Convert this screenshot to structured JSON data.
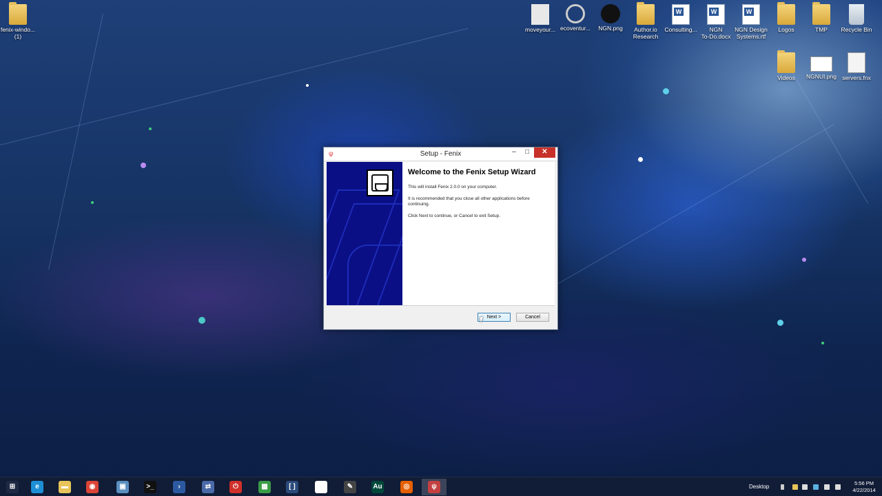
{
  "desktop": {
    "icons": [
      {
        "label": "fenix-windo...\n(1)",
        "kind": "folder"
      },
      {
        "label": "moveyour...",
        "kind": "image"
      },
      {
        "label": "ecoventur...",
        "kind": "app"
      },
      {
        "label": "NGN.png",
        "kind": "image"
      },
      {
        "label": "Author.io\nResearch",
        "kind": "folder"
      },
      {
        "label": "Consulting...",
        "kind": "doc"
      },
      {
        "label": "NGN\nTo-Do.docx",
        "kind": "doc"
      },
      {
        "label": "NGN Design\nSystems.rtf",
        "kind": "doc"
      },
      {
        "label": "Logos",
        "kind": "folder"
      },
      {
        "label": "TMP",
        "kind": "folder"
      },
      {
        "label": "Recycle Bin",
        "kind": "recycle"
      },
      {
        "label": "Videos",
        "kind": "folder"
      },
      {
        "label": "NGNUI.png",
        "kind": "image"
      },
      {
        "label": "servers.fnx",
        "kind": "file"
      }
    ]
  },
  "setup_window": {
    "title": "Setup - Fenix",
    "minimize_glyph": "–",
    "maximize_glyph": "□",
    "close_glyph": "✕",
    "heading": "Welcome to the Fenix Setup Wizard",
    "paragraphs": [
      "This will install Fenix 2.0.0 on your computer.",
      "It is recommended that you close all other applications before continuing.",
      "Click Next to continue, or Cancel to exit Setup."
    ],
    "next_label": "Next >",
    "cancel_label": "Cancel"
  },
  "taskbar": {
    "apps": [
      {
        "name": "start-button",
        "glyph": "⊞",
        "color": "#1e2a44"
      },
      {
        "name": "internet-explorer",
        "glyph": "e",
        "color": "#1e8fd6"
      },
      {
        "name": "file-explorer",
        "glyph": "▬",
        "color": "#e8c45a"
      },
      {
        "name": "chrome",
        "glyph": "◉",
        "color": "#db4437"
      },
      {
        "name": "remote-desktop",
        "glyph": "▣",
        "color": "#5a8fc0"
      },
      {
        "name": "command-prompt",
        "glyph": ">_",
        "color": "#111111"
      },
      {
        "name": "powershell",
        "glyph": "›",
        "color": "#2c5aa0"
      },
      {
        "name": "network-tool",
        "glyph": "⇄",
        "color": "#4a6aa8"
      },
      {
        "name": "power-app",
        "glyph": "⏻",
        "color": "#d0302a"
      },
      {
        "name": "app-grid",
        "glyph": "▦",
        "color": "#3a9c46"
      },
      {
        "name": "bracket-app",
        "glyph": "[ ]",
        "color": "#2a4a7a"
      },
      {
        "name": "blank-document",
        "glyph": "",
        "color": "#ffffff"
      },
      {
        "name": "pen-tool",
        "glyph": "✎",
        "color": "#444444"
      },
      {
        "name": "adobe-audition",
        "glyph": "Au",
        "color": "#00483a"
      },
      {
        "name": "firefox",
        "glyph": "◎",
        "color": "#e66000"
      },
      {
        "name": "fenix-setup",
        "glyph": "ψ",
        "color": "#c44040"
      }
    ],
    "desktop_label": "Desktop",
    "time": "5:56 PM",
    "date": "4/22/2014"
  }
}
